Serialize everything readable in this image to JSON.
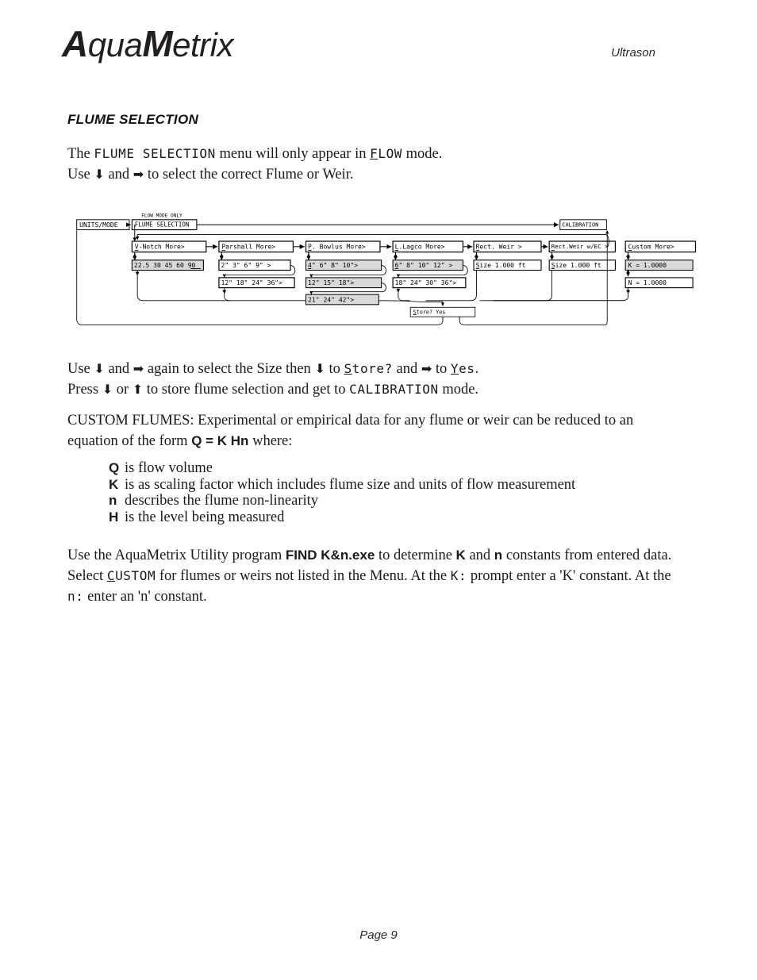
{
  "header": {
    "logo_part1": "A",
    "logo_part2": "qua",
    "logo_part3": "M",
    "logo_part4": "etrix",
    "right_label": "Ultrason"
  },
  "section": {
    "title": "FLUME SELECTION"
  },
  "intro": {
    "line1_a": "The ",
    "line1_menu": "FLUME SELECTION",
    "line1_b": " menu will only appear in ",
    "line1_mode_u": "F",
    "line1_mode_rest": "LOW",
    "line1_c": " mode.",
    "line2_a": "Use ",
    "arrow_down": "⬇",
    "line2_b": " and ",
    "arrow_right": "➡",
    "line2_c": " to select the correct Flume or Weir."
  },
  "use_block": {
    "l1_a": "Use ",
    "l1_b": " and ",
    "l1_c": " again to select the Size then ",
    "l1_d": " to ",
    "l1_store_u": "S",
    "l1_store_rest": "tore?",
    "l1_e": " and ",
    "l1_f": " to ",
    "l1_yes_u": "Y",
    "l1_yes_rest": "es",
    "l1_g": ".",
    "l2_a": "Press ",
    "l2_b": " or ",
    "arrow_up": "⬆",
    "l2_c": " to store flume selection and get to ",
    "l2_cal": "CALIBRATION",
    "l2_d": " mode."
  },
  "custom_para": {
    "l1": "CUSTOM FLUMES: Experimental or empirical data for any flume or weir can be reduced to an",
    "l2_a": "equation of the form ",
    "l2_eq": "Q = K Hn",
    "l2_b": "  where:"
  },
  "definitions": [
    {
      "symbol": "Q",
      "text": "is flow volume"
    },
    {
      "symbol": "K",
      "text": "is as scaling factor which includes flume size and units of flow measurement"
    },
    {
      "symbol": "n",
      "text": "describes the flume non-linearity"
    },
    {
      "symbol": "H",
      "text": "is the level being measured"
    }
  ],
  "final_para": {
    "l1_a": "Use the AquaMetrix Utility program ",
    "l1_prog": "FIND K&n.exe",
    "l1_b": " to determine ",
    "l1_k": "K",
    "l1_c": " and ",
    "l1_n": "n",
    "l1_d": " constants from entered data.",
    "l2_a": "Select ",
    "l2_custom_u": "C",
    "l2_custom_rest": "USTOM",
    "l2_b": " for flumes or weirs not listed in the Menu. At the ",
    "l2_kprompt": "K:",
    "l2_c": " prompt enter a 'K' constant. At the",
    "l3_nprompt": "n:",
    "l3_a": " enter an 'n' constant."
  },
  "footer": {
    "page_label": "Page 9"
  },
  "diagram": {
    "label_flow_mode_only": "FLOW MODE ONLY",
    "box_units_mode": "UNITS/MODE",
    "box_flume_selection": "FLUME SELECTION",
    "box_calibration": "CALIBRATION",
    "box_store": "Store?    Yes",
    "columns": [
      {
        "menu_u": "V",
        "menu_rest": "-Notch  More>",
        "sizes": [
          "22.5 30 45 60 90"
        ]
      },
      {
        "menu_u": "P",
        "menu_rest": "arshall  More>",
        "sizes": [
          "2\"   3\"   6\"   9\" >",
          "12\" 18\" 24\" 36\">"
        ]
      },
      {
        "menu_u": "P",
        "menu_rest": ". Bowlus More>",
        "sizes": [
          "4\"   6\"   8\"   10\">",
          "12\"    15\"    18\">",
          "21\"   24\"   42\">"
        ]
      },
      {
        "menu_u": "L",
        "menu_rest": ".Lagco   More>",
        "sizes": [
          "6\" 8\" 10\" 12\"  >",
          "18\" 24\" 30\" 36\">"
        ]
      },
      {
        "menu_u": "R",
        "menu_rest": "ect. Weir    >",
        "sizes": [
          "Size 1.000 ft"
        ]
      },
      {
        "menu_u": "R",
        "menu_rest": "ect.Weir w/EC >",
        "sizes": [
          "Size 1.000 ft"
        ]
      },
      {
        "menu_u": "C",
        "menu_rest": "ustom    More>",
        "sizes": [
          "K =  1.0000",
          "N =  1.0000"
        ]
      }
    ]
  },
  "colors": {
    "ink": "#111111",
    "lcd_fill": "#d9d9d9",
    "paper": "#ffffff"
  }
}
